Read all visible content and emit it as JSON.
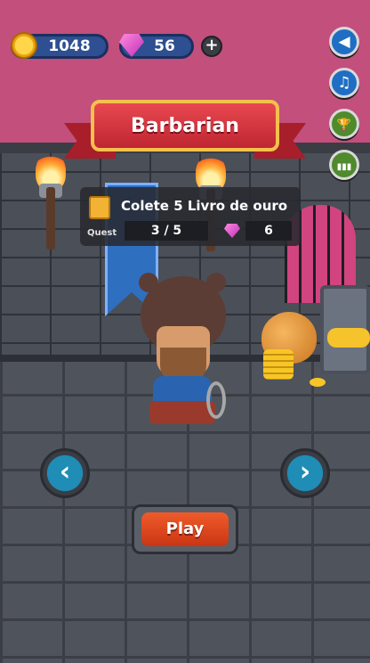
{
  "currency": {
    "coins": "1048",
    "gems": "56",
    "add_label": "+"
  },
  "side_menu": {
    "sound_icon": "◀",
    "music_icon": "♫",
    "trophy_icon": "🏆",
    "leaderboard_icon": "▮▮▮"
  },
  "character": {
    "name": "Barbarian"
  },
  "quest": {
    "label": "Quest",
    "title": "Colete 5 Livro de ouro",
    "progress": "3 / 5",
    "reward": "6"
  },
  "nav": {
    "prev_icon": "‹",
    "next_icon": "›"
  },
  "actions": {
    "play_label": "Play"
  },
  "colors": {
    "upper_wall": "#c24f7c",
    "ribbon_red": "#e84850",
    "button_blue": "#1f6ec4",
    "play_orange": "#f05a2a"
  }
}
